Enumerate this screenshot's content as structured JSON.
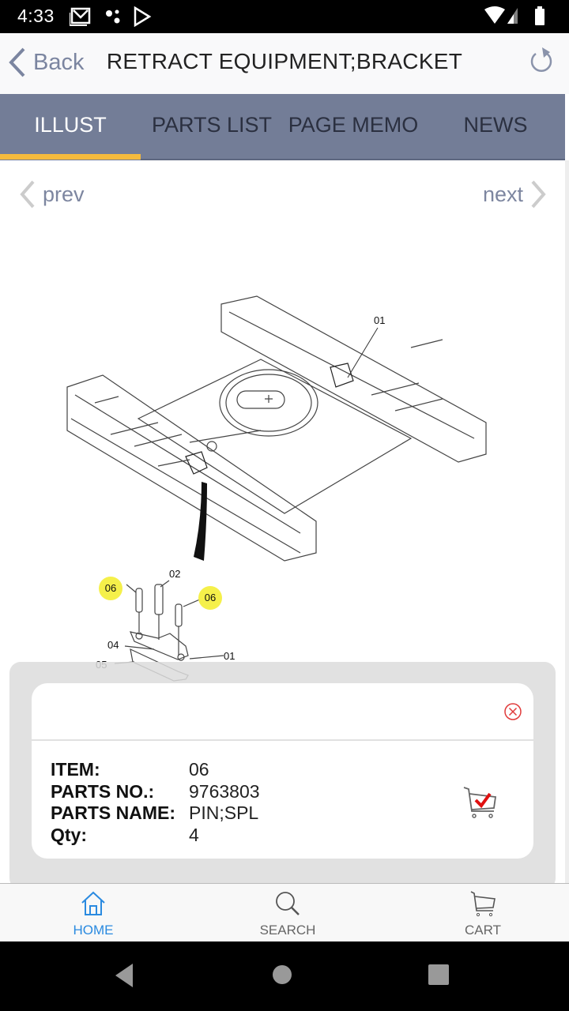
{
  "status_bar": {
    "time": "4:33",
    "icons": [
      "gmail-icon",
      "dots-icon",
      "play-store-icon",
      "wifi-icon",
      "signal-icon",
      "battery-icon"
    ]
  },
  "app_bar": {
    "back_label": "Back",
    "title": "RETRACT EQUIPMENT;BRACKET",
    "refresh_icon": "refresh-icon"
  },
  "tabs": [
    {
      "label": "ILLUST",
      "active": true
    },
    {
      "label": "PARTS LIST",
      "active": false
    },
    {
      "label": "PAGE MEMO",
      "active": false
    },
    {
      "label": "NEWS",
      "active": false
    }
  ],
  "pager": {
    "prev_label": "prev",
    "next_label": "next"
  },
  "illustration": {
    "callouts": [
      "01",
      "02",
      "04",
      "05",
      "06",
      "06",
      "01"
    ],
    "highlighted": "06"
  },
  "popup": {
    "fields": [
      {
        "key": "ITEM:",
        "value": "06"
      },
      {
        "key": "PARTS NO.:",
        "value": "9763803"
      },
      {
        "key": "PARTS NAME:",
        "value": "PIN;SPL"
      },
      {
        "key": "Qty:",
        "value": "4"
      }
    ]
  },
  "bottom_nav": [
    {
      "label": "HOME",
      "icon": "home-icon",
      "active": true
    },
    {
      "label": "SEARCH",
      "icon": "search-icon",
      "active": false
    },
    {
      "label": "CART",
      "icon": "cart-icon",
      "active": false
    }
  ],
  "colors": {
    "accent": "#f5bb3d",
    "tab_bg": "#737d97",
    "active_nav": "#2a8ae0",
    "highlight": "#f5f04a",
    "close": "#e03a3a"
  }
}
